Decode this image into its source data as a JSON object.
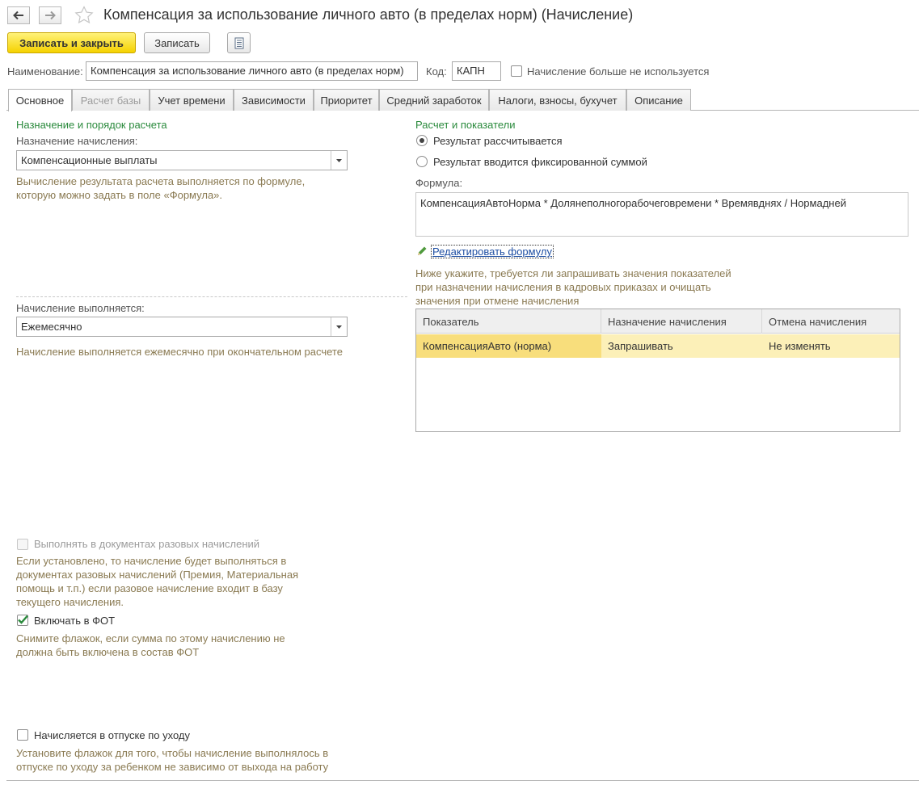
{
  "window": {
    "title": "Компенсация за использование личного авто (в пределах норм) (Начисление)"
  },
  "toolbar": {
    "save_close_label": "Записать и закрыть",
    "save_label": "Записать"
  },
  "header": {
    "name_label": "Наименование:",
    "name_value": "Компенсация за использование личного авто (в пределах норм)",
    "code_label": "Код:",
    "code_value": "КАПН",
    "unused_label": "Начисление больше не используется",
    "unused_checked": false
  },
  "tabs": [
    {
      "label": "Основное",
      "active": true,
      "disabled": false
    },
    {
      "label": "Расчет базы",
      "active": false,
      "disabled": true
    },
    {
      "label": "Учет времени",
      "active": false,
      "disabled": false
    },
    {
      "label": "Зависимости",
      "active": false,
      "disabled": false
    },
    {
      "label": "Приоритет",
      "active": false,
      "disabled": false
    },
    {
      "label": "Средний заработок",
      "active": false,
      "disabled": false
    },
    {
      "label": "Налоги, взносы, бухучет",
      "active": false,
      "disabled": false
    },
    {
      "label": "Описание",
      "active": false,
      "disabled": false
    }
  ],
  "left": {
    "section_title": "Назначение и порядок расчета",
    "purpose_label": "Назначение начисления:",
    "purpose_value": "Компенсационные выплаты",
    "purpose_hint_1": "Вычисление результата расчета выполняется по формуле,",
    "purpose_hint_2": "которую можно задать в поле «Формула».",
    "period_label": "Начисление выполняется:",
    "period_value": "Ежемесячно",
    "period_hint": "Начисление выполняется ежемесячно при окончательном расчете",
    "onetime_label": "Выполнять в документах разовых начислений",
    "onetime_hint": "Если установлено, то начисление будет выполняться в документах разовых начислений (Премия, Материальная помощь и т.п.) если разовое начисление входит в базу текущего начисления.",
    "fot_label": "Включать в ФОТ",
    "fot_checked": true,
    "fot_hint": "Снимите флажок, если сумма по этому начислению не должна быть включена в состав ФОТ",
    "leave_label": "Начисляется в отпуске по уходу",
    "leave_checked": false,
    "leave_hint": "Установите флажок для того, чтобы начисление выполнялось в отпуске по уходу за ребенком не зависимо от выхода на работу"
  },
  "right": {
    "section_title": "Расчет и показатели",
    "radio_calculated": "Результат рассчитывается",
    "radio_fixed": "Результат вводится фиксированной суммой",
    "selected_radio": "calculated",
    "formula_label": "Формула:",
    "formula_value": "КомпенсацияАвтоНорма * Долянеполногорабочеговремени * Времявднях / Нормадней",
    "edit_formula_link": "Редактировать формулу",
    "indicators_hint": "Ниже укажите, требуется ли запрашивать значения показателей при назначении начисления в кадровых приказах и очищать значения при отмене начисления",
    "table": {
      "columns": [
        "Показатель",
        "Назначение начисления",
        "Отмена начисления"
      ],
      "rows": [
        [
          "КомпенсацияАвто (норма)",
          "Запрашивать",
          "Не изменять"
        ]
      ]
    }
  },
  "colors": {
    "primary_button": "#f5d200",
    "section_title": "#2a8a3c",
    "hint_text": "#8a7a52",
    "link": "#1f4fa3",
    "selected_row": "#fcf0b8"
  }
}
